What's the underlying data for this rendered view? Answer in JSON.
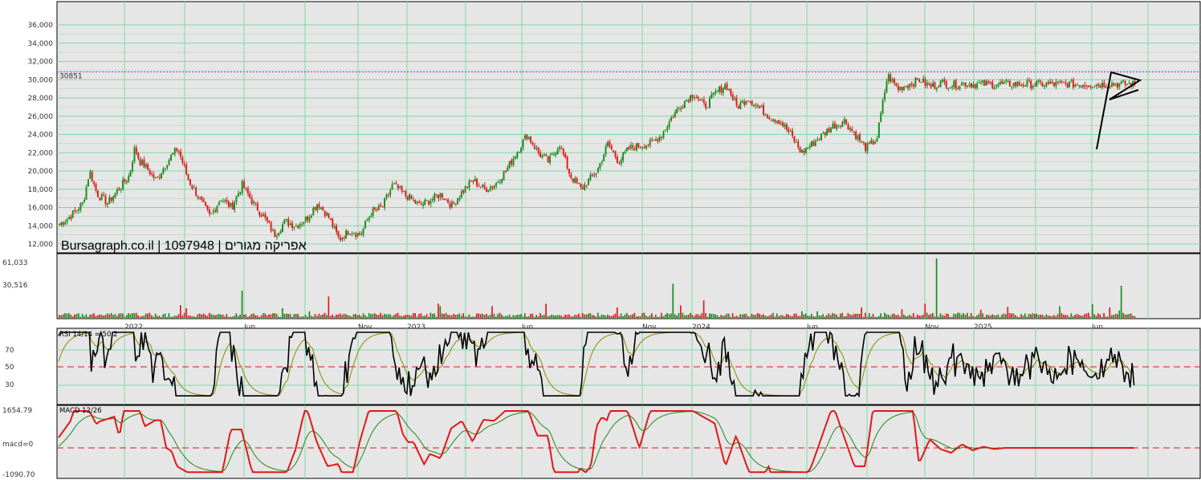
{
  "colors": {
    "panel_bg": "#e6e6e6",
    "grid": "#7dd9a8",
    "up": "#1a8a1a",
    "down": "#e01818",
    "volume_up": "#1a8a1a",
    "volume_down": "#e01818",
    "price_ref": "#a020f0",
    "rsi_line": "#000000",
    "rsi_signal": "#8a8a00",
    "macd_line": "#e01818",
    "macd_signal": "#1a8a1a",
    "mid_line": "#e01818",
    "pattern": "#000000"
  },
  "watermark": "Bursagraph.co.il | 1097948 | אפריקה מגורים",
  "date_labels": [
    "2022",
    "Jun",
    "Nov",
    "2023",
    "Jun",
    "Nov",
    "2024",
    "Jun",
    "Nov",
    "2025",
    "Jun"
  ],
  "price_panel": {
    "y_ticks": [
      "36,000",
      "34,000",
      "32,000",
      "30,000",
      "28,000",
      "26,000",
      "24,000",
      "22,000",
      "20,000",
      "18,000",
      "16,000",
      "14,000",
      "12,000"
    ],
    "ref_label": "30851"
  },
  "volume_panel": {
    "y_ticks": [
      "61,033",
      "30,516"
    ]
  },
  "rsi_panel": {
    "title": "RSI 14/14 = 50.2",
    "y_ticks": [
      "70",
      "50",
      "30"
    ]
  },
  "macd_panel": {
    "title": "MACD 12/26",
    "y_ticks": [
      "1654.79",
      "macd=0",
      "-1090.70"
    ]
  },
  "chart_data": [
    {
      "type": "candlestick",
      "series_keypoints_date_fraction": [
        0,
        0.008,
        0.022,
        0.028,
        0.035,
        0.045,
        0.055,
        0.065,
        0.07,
        0.075,
        0.08,
        0.09,
        0.1,
        0.11,
        0.12,
        0.13,
        0.14,
        0.15,
        0.16,
        0.17,
        0.18,
        0.19,
        0.2,
        0.21,
        0.22,
        0.23,
        0.24,
        0.25,
        0.26,
        0.27,
        0.28,
        0.29,
        0.3,
        0.31,
        0.32,
        0.335,
        0.345,
        0.355,
        0.365,
        0.375,
        0.385,
        0.395,
        0.405,
        0.415,
        0.425,
        0.435,
        0.445,
        0.455,
        0.465,
        0.475,
        0.485,
        0.5,
        0.51,
        0.52,
        0.53,
        0.54,
        0.55,
        0.56,
        0.57,
        0.58,
        0.59,
        0.6,
        0.61,
        0.62,
        0.63,
        0.64,
        0.65,
        0.66,
        0.67,
        0.68,
        0.69,
        0.7,
        0.71,
        0.72,
        0.73,
        0.74,
        0.75,
        0.76,
        0.77,
        0.78,
        0.79,
        0.8,
        0.81,
        0.82,
        0.83,
        0.84,
        0.85,
        0.86,
        0.87,
        0.88,
        0.89,
        0.9,
        0.91,
        0.92,
        0.93,
        0.94,
        0.95,
        0.96,
        0.97,
        0.98,
        0.985,
        0.99,
        1.0
      ],
      "close_keypoints": [
        14200,
        14800,
        16500,
        20000,
        17500,
        16500,
        18000,
        19500,
        22500,
        21000,
        20500,
        19000,
        21000,
        22500,
        19000,
        17000,
        15000,
        17000,
        16000,
        18500,
        16500,
        15000,
        13000,
        14500,
        14000,
        14800,
        16500,
        15000,
        12500,
        13500,
        13000,
        15500,
        16000,
        18500,
        17500,
        16200,
        16800,
        17500,
        16200,
        17800,
        19000,
        18000,
        18500,
        20000,
        22000,
        24000,
        22000,
        21000,
        23000,
        19500,
        18000,
        20000,
        23000,
        21000,
        22500,
        22800,
        23000,
        24000,
        26000,
        27500,
        28500,
        27000,
        28500,
        29500,
        27000,
        28000,
        27000,
        26000,
        25500,
        24000,
        22000,
        23000,
        24000,
        25000,
        25500,
        24000,
        22500,
        23500,
        30500,
        29000,
        29500,
        30000,
        29200,
        29700,
        29400,
        29600,
        29500,
        29500,
        29500,
        29500,
        29500,
        29500,
        29500,
        29500,
        29500,
        29500,
        29500,
        29500,
        29500,
        29500,
        29500,
        29500,
        29500
      ],
      "price_range": [
        12000,
        37000
      ],
      "y_ticks": [
        36000,
        34000,
        32000,
        30000,
        28000,
        26000,
        24000,
        22000,
        20000,
        18000,
        16000,
        14000,
        12000
      ],
      "reference_line": 30851,
      "x_labels": [
        "2022",
        "Jun",
        "Nov",
        "2023",
        "Jun",
        "Nov",
        "2024",
        "Jun",
        "Nov",
        "2025",
        "Jun"
      ]
    },
    {
      "type": "bar",
      "title": "",
      "y_ticks": [
        61033,
        30516
      ],
      "ylim": [
        0,
        66000
      ],
      "spike_values": [
        61033,
        35000,
        33000,
        28000,
        22000,
        18000,
        14000,
        12000
      ]
    },
    {
      "type": "line",
      "title": "RSI 14/14 = 50.2",
      "y_ticks": [
        70,
        50,
        30
      ],
      "last_value": 50.2,
      "midline": 50
    },
    {
      "type": "line",
      "title": "MACD 12/26",
      "y_ticks": [
        "1654.79",
        "macd=0",
        "-1090.70"
      ],
      "ylim": [
        -1090.7,
        1654.79
      ],
      "zero_line": 0
    }
  ]
}
